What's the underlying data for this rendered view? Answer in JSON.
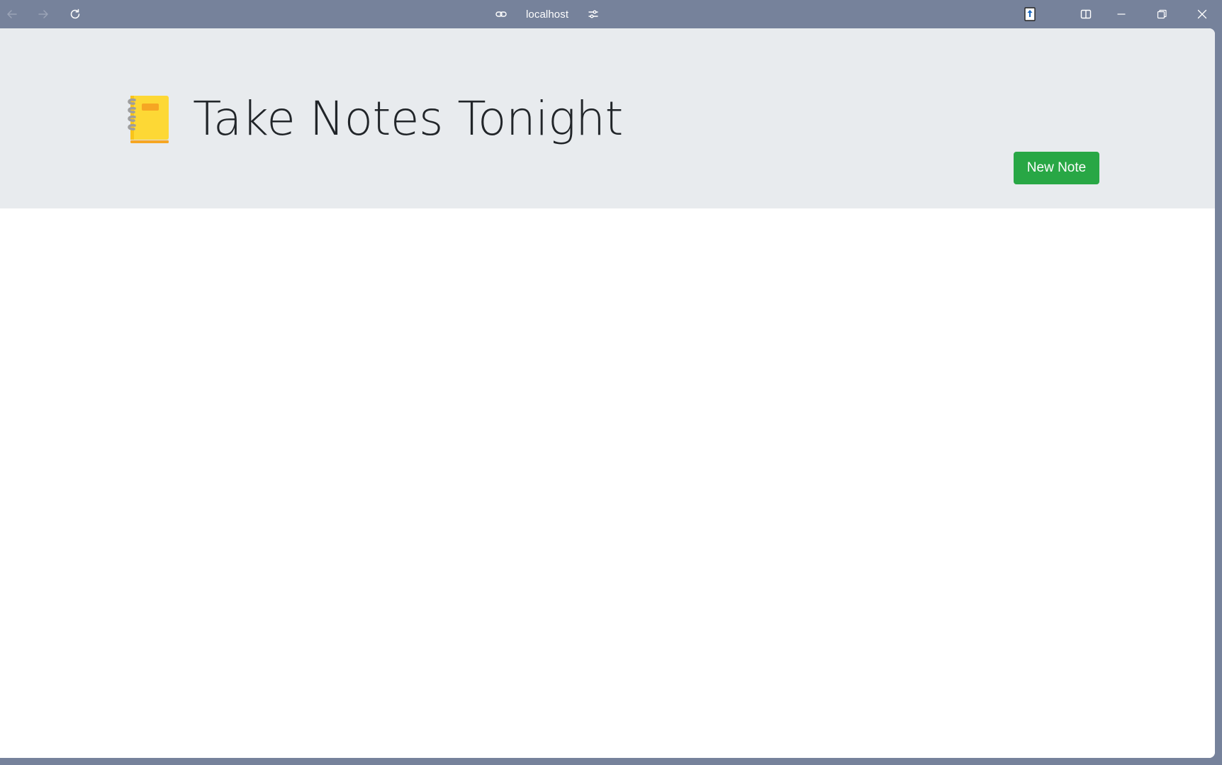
{
  "browser": {
    "url": "localhost",
    "icons": {
      "back": "arrow-left-icon",
      "forward": "arrow-right-icon",
      "reload": "refresh-icon",
      "link": "link-icon",
      "site_settings": "sliders-icon",
      "extension": "extension-icon",
      "split_view": "split-view-icon",
      "minimize": "minimize-icon",
      "restore": "restore-icon",
      "close": "close-icon"
    },
    "colors": {
      "chrome": "#76829b",
      "icon": "#ffffff"
    }
  },
  "page": {
    "title": "Take Notes Tonight",
    "logo_icon": "notebook-icon",
    "new_note_label": "New Note",
    "colors": {
      "header_bg": "#e8ebee",
      "button_bg": "#28a745",
      "title_text": "#212529",
      "notebook_cover": "#fdd835"
    }
  }
}
